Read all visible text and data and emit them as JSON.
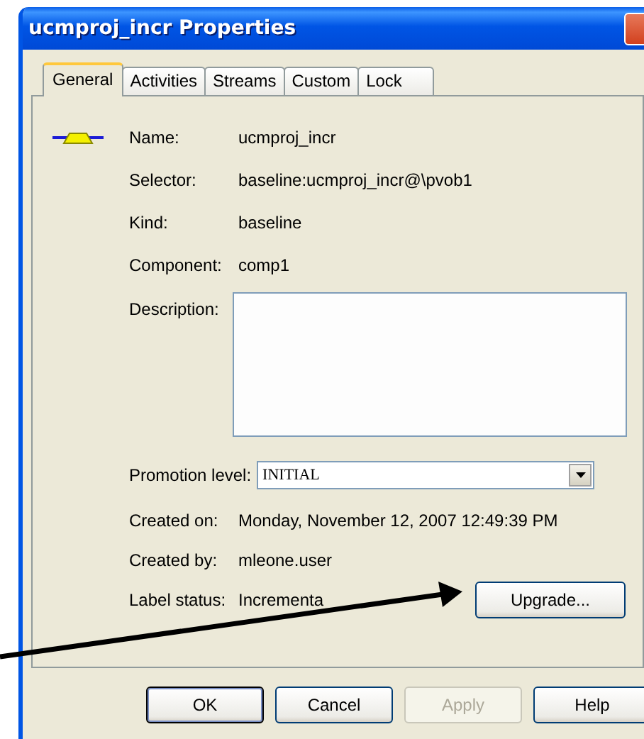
{
  "window": {
    "title": "ucmproj_incr Properties"
  },
  "tabs": [
    {
      "label": "General",
      "selected": true
    },
    {
      "label": "Activities",
      "selected": false
    },
    {
      "label": "Streams",
      "selected": false
    },
    {
      "label": "Custom",
      "selected": false
    },
    {
      "label": "Lock",
      "selected": false
    }
  ],
  "fields": [
    {
      "label": "Name:",
      "value": "ucmproj_incr"
    },
    {
      "label": "Selector:",
      "value": "baseline:ucmproj_incr@\\pvob1"
    },
    {
      "label": "Kind:",
      "value": "baseline"
    },
    {
      "label": "Component:",
      "value": "comp1"
    }
  ],
  "description": {
    "label": "Description:"
  },
  "promotion_level": {
    "label": "Promotion level:",
    "value": "INITIAL"
  },
  "info": [
    {
      "label": "Created on:",
      "value": "Monday, November 12, 2007 12:49:39 PM"
    },
    {
      "label": "Created by:",
      "value": "mleone.user"
    },
    {
      "label": "Label status:",
      "value": "Incrementa"
    }
  ],
  "upgrade_button": "Upgrade...",
  "buttons": [
    {
      "label": "OK",
      "disabled": false,
      "default": true
    },
    {
      "label": "Cancel",
      "disabled": false,
      "default": false
    },
    {
      "label": "Apply",
      "disabled": true,
      "default": false
    },
    {
      "label": "Help",
      "disabled": false,
      "default": false
    }
  ]
}
